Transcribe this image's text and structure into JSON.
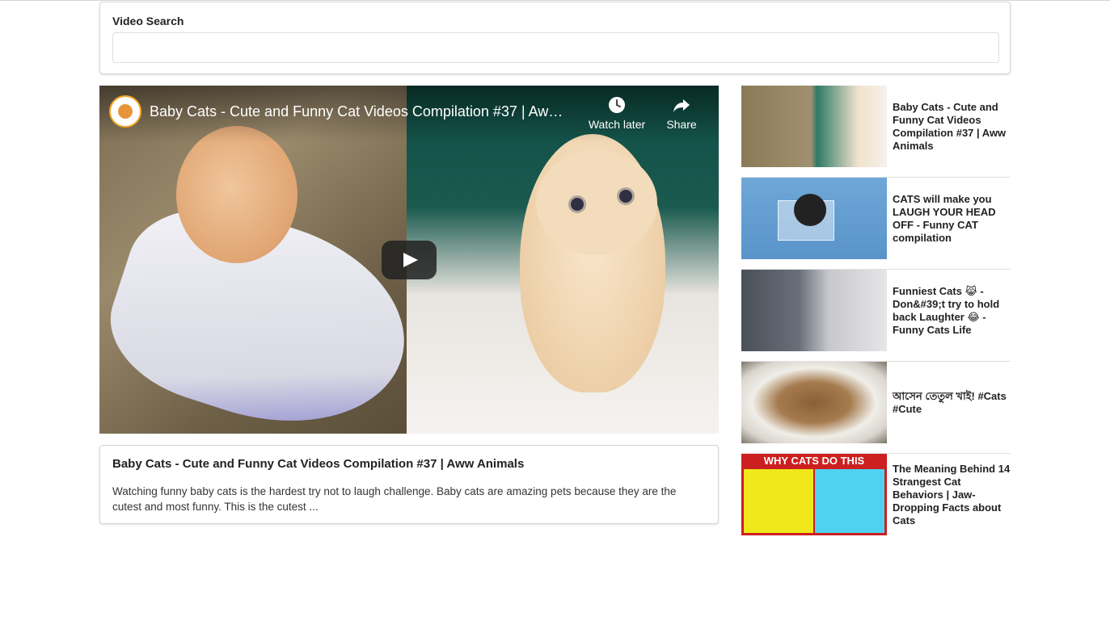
{
  "search": {
    "label": "Video Search",
    "value": "",
    "placeholder": ""
  },
  "player": {
    "title": "Baby Cats - Cute and Funny Cat Videos Compilation #37 | Aww Animals",
    "title_display": "Baby Cats - Cute and Funny Cat Videos Compilation #37 | Aww A...",
    "watch_later_label": "Watch later",
    "share_label": "Share",
    "icons": [
      "clock-icon",
      "share-icon",
      "play-icon"
    ]
  },
  "selected_video": {
    "title": "Baby Cats - Cute and Funny Cat Videos Compilation #37 | Aww Animals",
    "description": "Watching funny baby cats is the hardest try not to laugh challenge. Baby cats are amazing pets because they are the cutest and most funny. This is the cutest ..."
  },
  "video_list": [
    {
      "title": "Baby Cats - Cute and Funny Cat Videos Compilation #37 | Aww Animals"
    },
    {
      "title": "CATS will make you LAUGH YOUR HEAD OFF - Funny CAT compilation"
    },
    {
      "title": "Funniest Cats 😹 - Don&#39;t try to hold back Laughter 😂 - Funny Cats Life"
    },
    {
      "title": "আসেন তেতুল খাই! #Cats #Cute"
    },
    {
      "title": "The Meaning Behind 14 Strangest Cat Behaviors | Jaw-Dropping Facts about Cats",
      "thumb_banner": "WHY CATS DO THIS"
    }
  ]
}
